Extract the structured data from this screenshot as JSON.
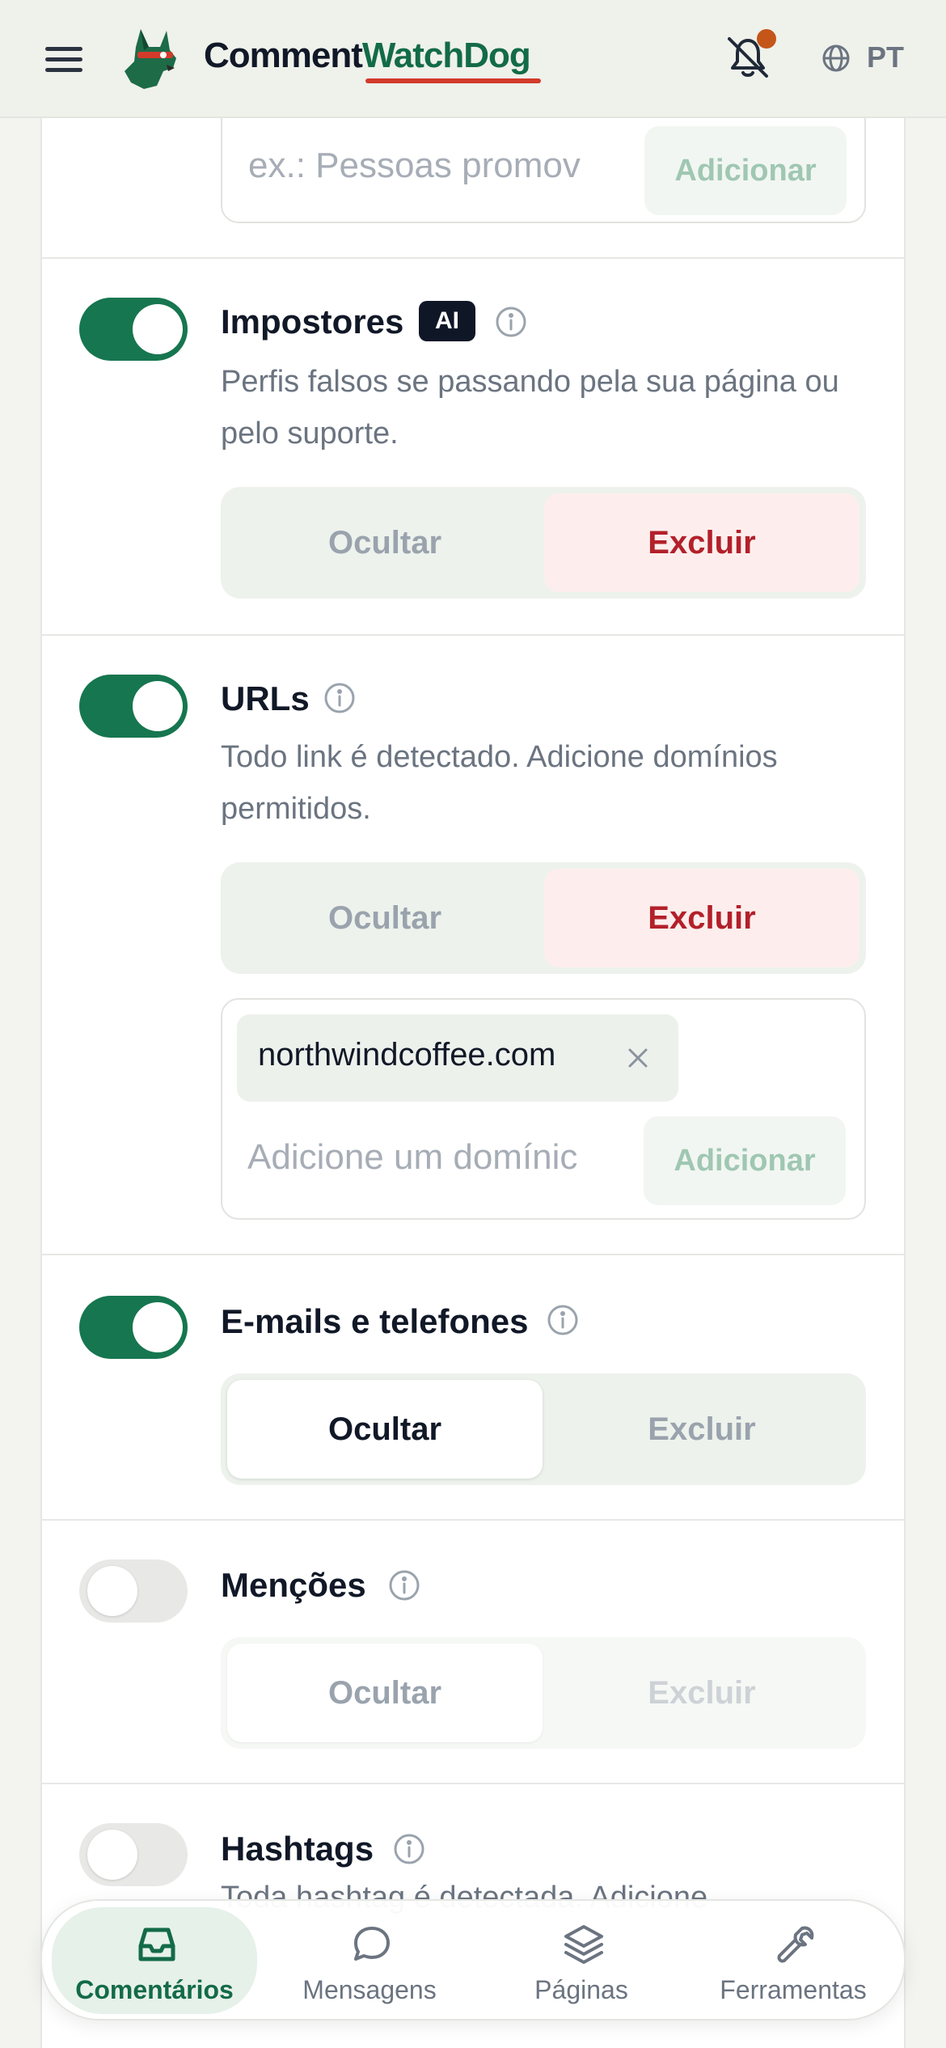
{
  "header": {
    "brand_part1": "Comment",
    "brand_part2": "WatchDog",
    "language": "PT",
    "colors": {
      "brand_green": "#136b47",
      "brand_red": "#d23b2b",
      "notification_dot": "#c4561a"
    }
  },
  "top_input": {
    "placeholder": "ex.: Pessoas promov",
    "add_label": "Adicionar"
  },
  "rules": {
    "impostores": {
      "title": "Impostores",
      "badge": "AI",
      "description": "Perfis falsos se passando pela sua página ou pelo suporte.",
      "enabled": true,
      "hide_label": "Ocultar",
      "delete_label": "Excluir",
      "selected": "Excluir"
    },
    "urls": {
      "title": "URLs",
      "description": "Todo link é detectado. Adicione domínios permitidos.",
      "enabled": true,
      "hide_label": "Ocultar",
      "delete_label": "Excluir",
      "selected": "Excluir",
      "allowed_domains": [
        "northwindcoffee.com"
      ],
      "domain_placeholder": "Adicione um domínic",
      "add_label": "Adicionar"
    },
    "emails": {
      "title": "E-mails e telefones",
      "enabled": true,
      "hide_label": "Ocultar",
      "delete_label": "Excluir",
      "selected": "Ocultar"
    },
    "mencoes": {
      "title": "Menções",
      "enabled": false,
      "hide_label": "Ocultar",
      "delete_label": "Excluir",
      "selected": "Ocultar"
    },
    "hashtags": {
      "title": "Hashtags",
      "enabled": false,
      "description_peek": "Toda hashtag é detectada. Adicione"
    }
  },
  "bottom_nav": {
    "items": [
      {
        "label": "Comentários",
        "icon": "inbox-icon",
        "active": true
      },
      {
        "label": "Mensagens",
        "icon": "chat-bubble-icon",
        "active": false
      },
      {
        "label": "Páginas",
        "icon": "layers-icon",
        "active": false
      },
      {
        "label": "Ferramentas",
        "icon": "wrench-icon",
        "active": false
      }
    ]
  }
}
